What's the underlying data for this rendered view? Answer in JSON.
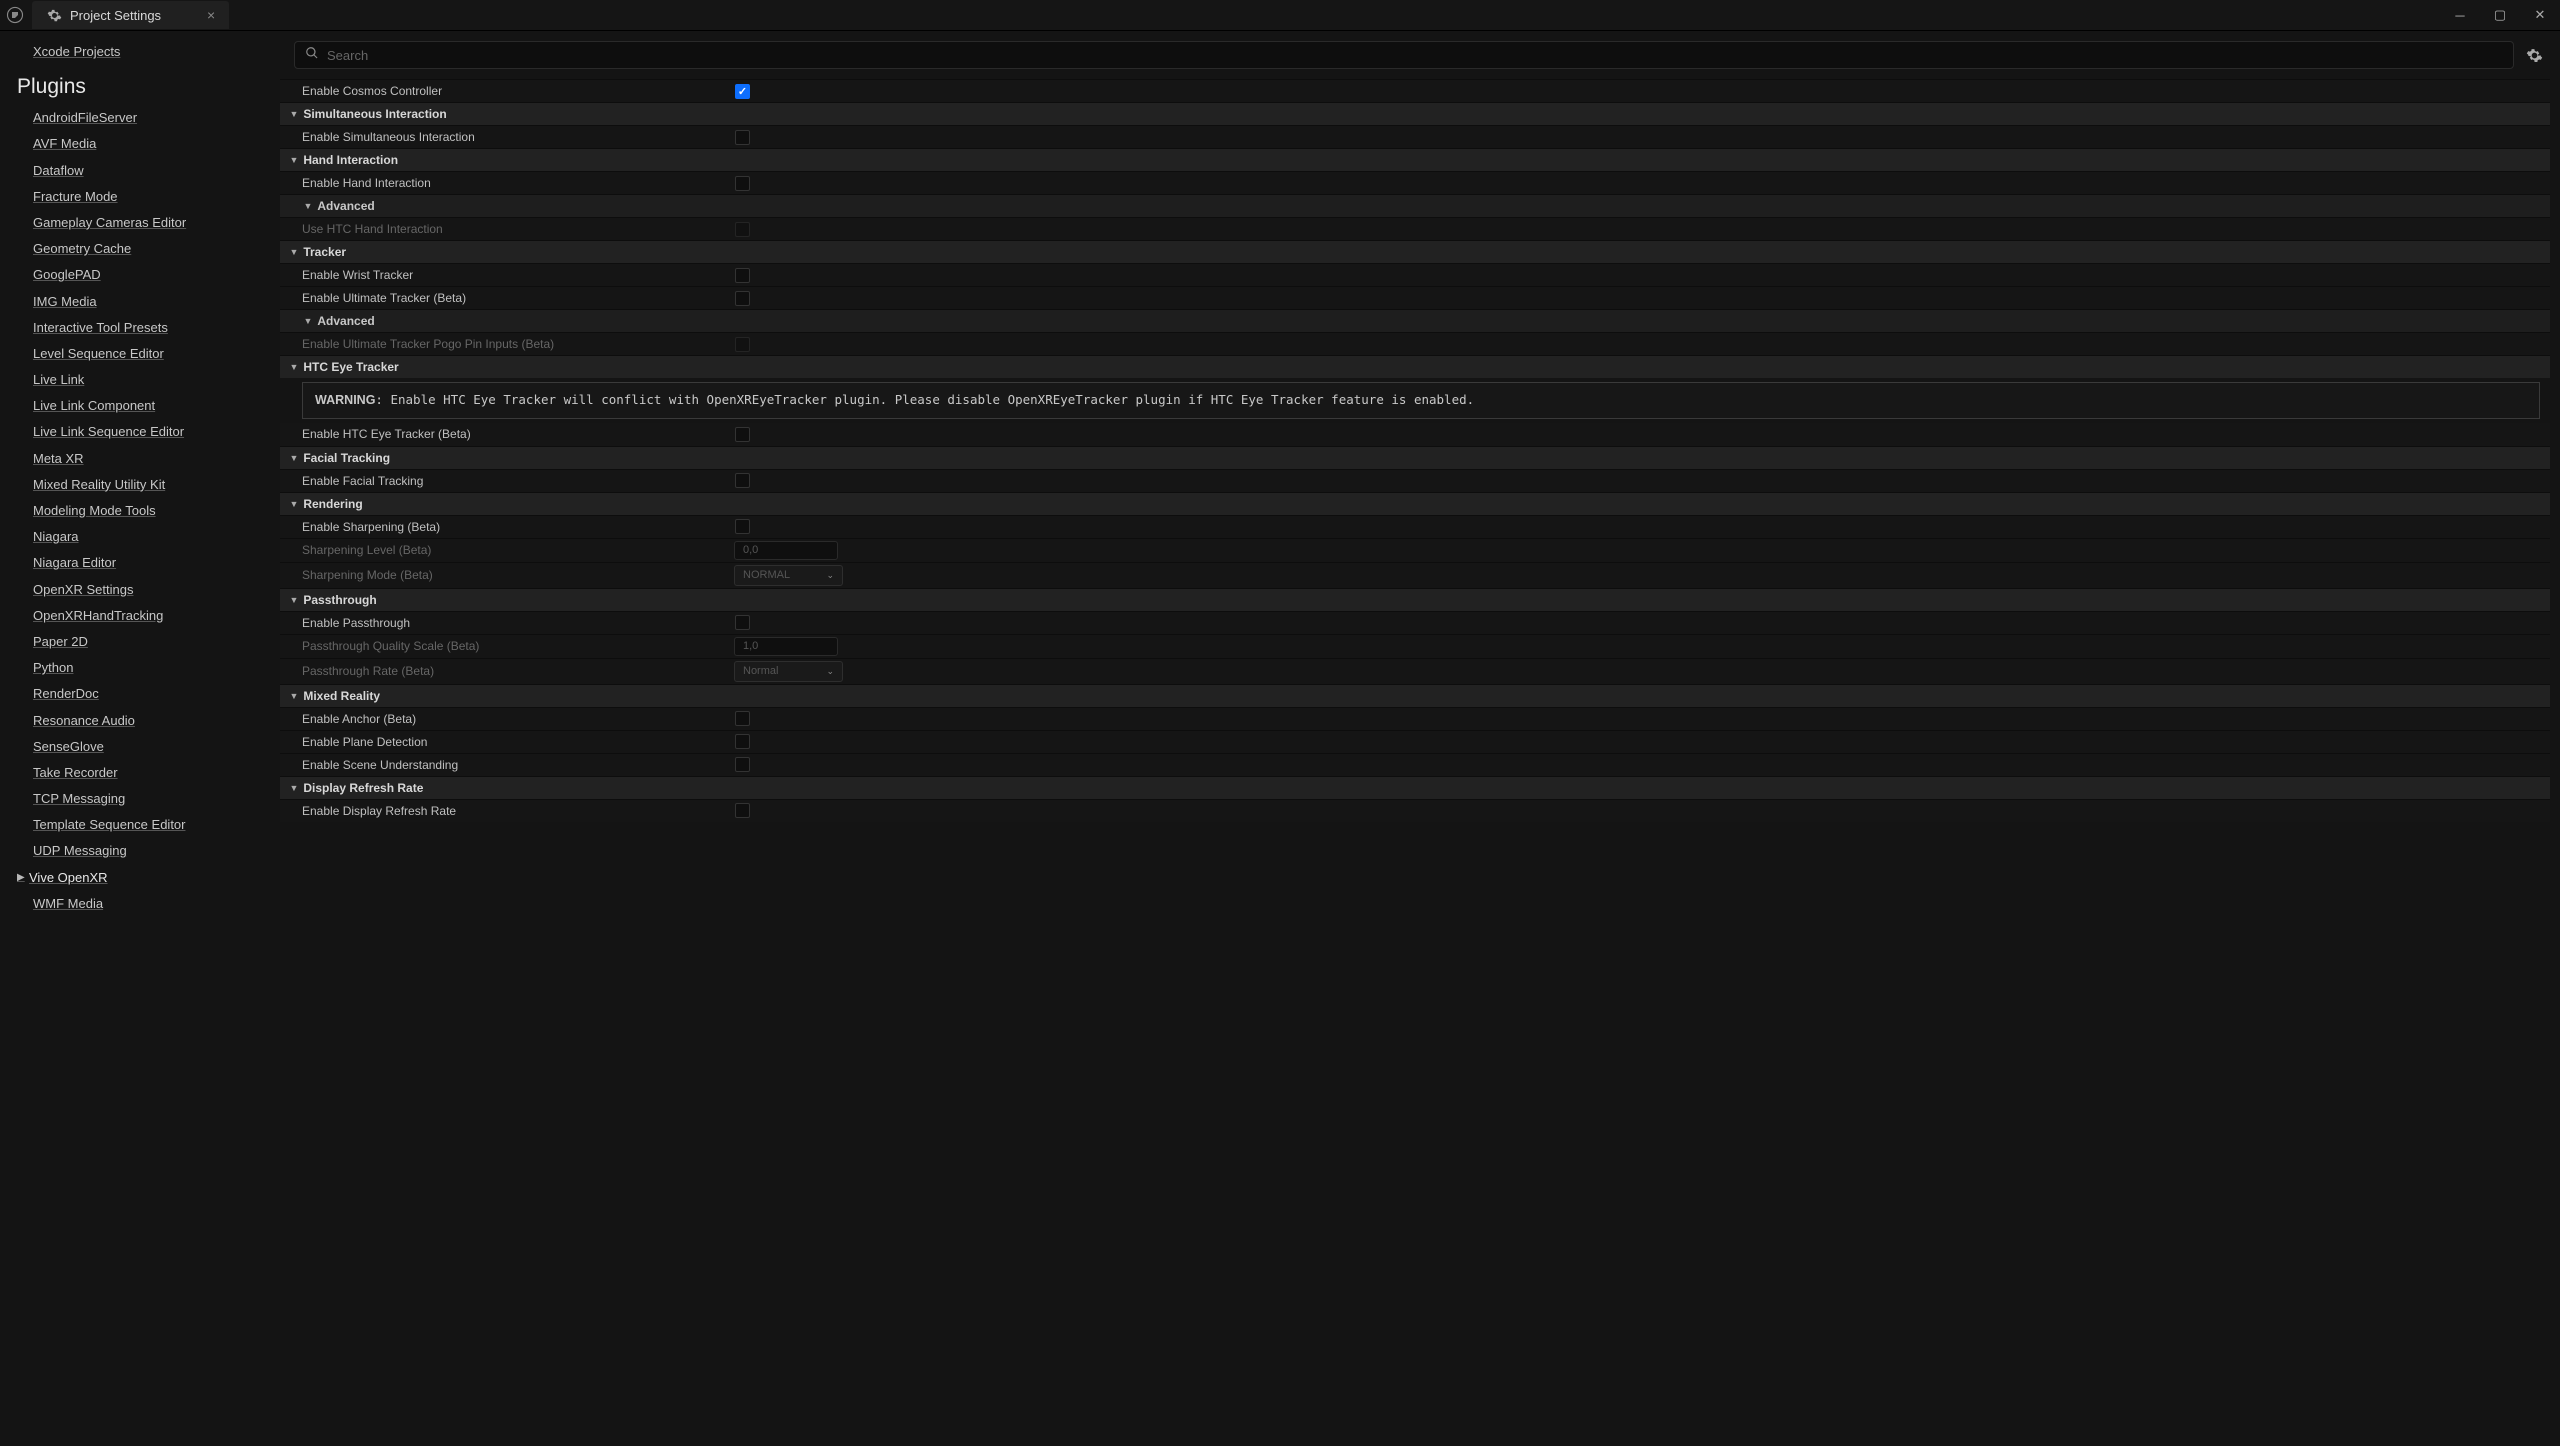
{
  "titlebar": {
    "tab_title": "Project Settings"
  },
  "search": {
    "placeholder": "Search"
  },
  "sidebar": {
    "top_item": "Xcode Projects",
    "section": "Plugins",
    "items": [
      "AndroidFileServer",
      "AVF Media",
      "Dataflow",
      "Fracture Mode",
      "Gameplay Cameras Editor",
      "Geometry Cache",
      "GooglePAD",
      "IMG Media",
      "Interactive Tool Presets",
      "Level Sequence Editor",
      "Live Link",
      "Live Link Component",
      "Live Link Sequence Editor",
      "Meta XR",
      "Mixed Reality Utility Kit",
      "Modeling Mode Tools",
      "Niagara",
      "Niagara Editor",
      "OpenXR Settings",
      "OpenXRHandTracking",
      "Paper 2D",
      "Python",
      "RenderDoc",
      "Resonance Audio",
      "SenseGlove",
      "Take Recorder",
      "TCP Messaging",
      "Template Sequence Editor",
      "UDP Messaging",
      "Vive OpenXR",
      "WMF Media"
    ],
    "selected": "Vive OpenXR"
  },
  "settings": {
    "enable_cosmos": {
      "label": "Enable Cosmos Controller",
      "checked": true
    },
    "cat_simul": "Simultaneous Interaction",
    "enable_simul": {
      "label": "Enable Simultaneous Interaction",
      "checked": false
    },
    "cat_hand": "Hand Interaction",
    "enable_hand": {
      "label": "Enable Hand Interaction",
      "checked": false
    },
    "sub_adv1": "Advanced",
    "use_htc_hand": {
      "label": "Use HTC Hand Interaction",
      "checked": false
    },
    "cat_tracker": "Tracker",
    "enable_wrist": {
      "label": "Enable Wrist Tracker",
      "checked": false
    },
    "enable_ult": {
      "label": "Enable Ultimate Tracker (Beta)",
      "checked": false
    },
    "sub_adv2": "Advanced",
    "enable_pogo": {
      "label": "Enable Ultimate Tracker Pogo Pin Inputs (Beta)",
      "checked": false
    },
    "cat_eye": "HTC Eye Tracker",
    "warning_label": "WARNING",
    "warning_text": ": Enable HTC Eye Tracker will conflict with OpenXREyeTracker plugin. Please disable OpenXREyeTracker plugin if HTC Eye Tracker feature is enabled.",
    "enable_eye": {
      "label": "Enable HTC Eye Tracker (Beta)",
      "checked": false
    },
    "cat_facial": "Facial Tracking",
    "enable_facial": {
      "label": "Enable Facial Tracking",
      "checked": false
    },
    "cat_render": "Rendering",
    "enable_sharp": {
      "label": "Enable Sharpening (Beta)",
      "checked": false
    },
    "sharp_level": {
      "label": "Sharpening Level (Beta)",
      "value": "0,0"
    },
    "sharp_mode": {
      "label": "Sharpening Mode (Beta)",
      "value": "NORMAL"
    },
    "cat_pass": "Passthrough",
    "enable_pass": {
      "label": "Enable Passthrough",
      "checked": false
    },
    "pass_quality": {
      "label": "Passthrough Quality Scale (Beta)",
      "value": "1,0"
    },
    "pass_rate": {
      "label": "Passthrough Rate (Beta)",
      "value": "Normal"
    },
    "cat_mr": "Mixed Reality",
    "enable_anchor": {
      "label": "Enable Anchor (Beta)",
      "checked": false
    },
    "enable_plane": {
      "label": "Enable Plane Detection",
      "checked": false
    },
    "enable_scene": {
      "label": "Enable Scene Understanding",
      "checked": false
    },
    "cat_disp": "Display Refresh Rate",
    "enable_disp": {
      "label": "Enable Display Refresh Rate",
      "checked": false
    }
  }
}
